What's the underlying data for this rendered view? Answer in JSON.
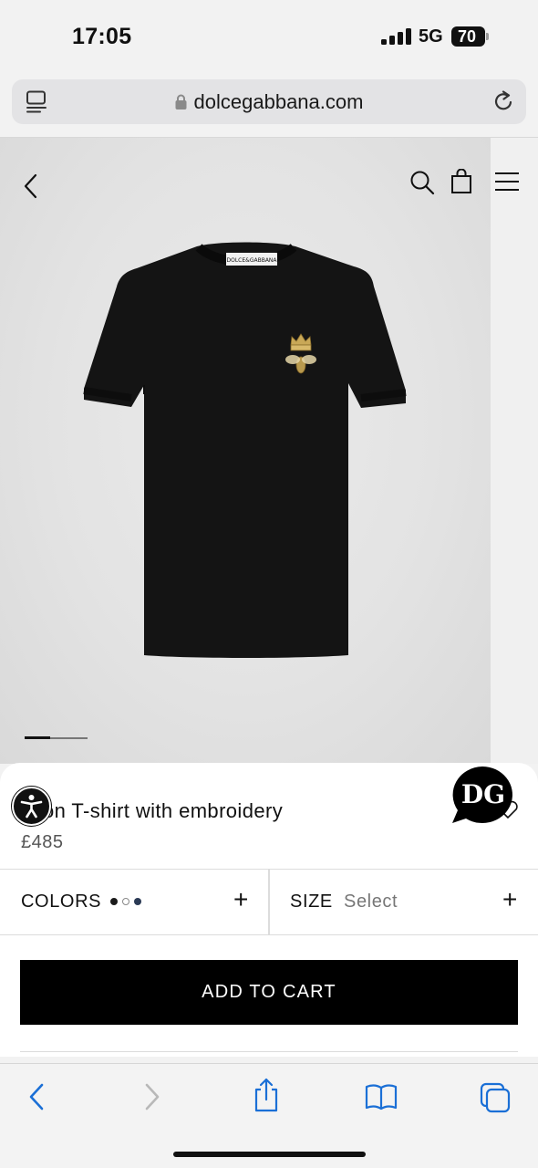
{
  "status_bar": {
    "time": "17:05",
    "network": "5G",
    "battery": "70"
  },
  "browser": {
    "url": "dolcegabbana.com"
  },
  "shirt_label": "DOLCE&GABBANA",
  "product": {
    "name": "Cotton T-shirt with embroidery",
    "name_visible": "tton T-shirt with embroidery",
    "price": "£485"
  },
  "options": {
    "colors_label": "COLORS",
    "color_swatches": [
      "#1a1a1a",
      "#ffffff",
      "#2b3a55"
    ],
    "size_label": "SIZE",
    "size_value": "Select",
    "plus": "+"
  },
  "cart_button": "ADD TO CART",
  "chat_logo": "DG",
  "colors": {
    "accent": "#1a6fd6",
    "cta_bg": "#000000",
    "hero_bg": "#e3e3e3"
  }
}
